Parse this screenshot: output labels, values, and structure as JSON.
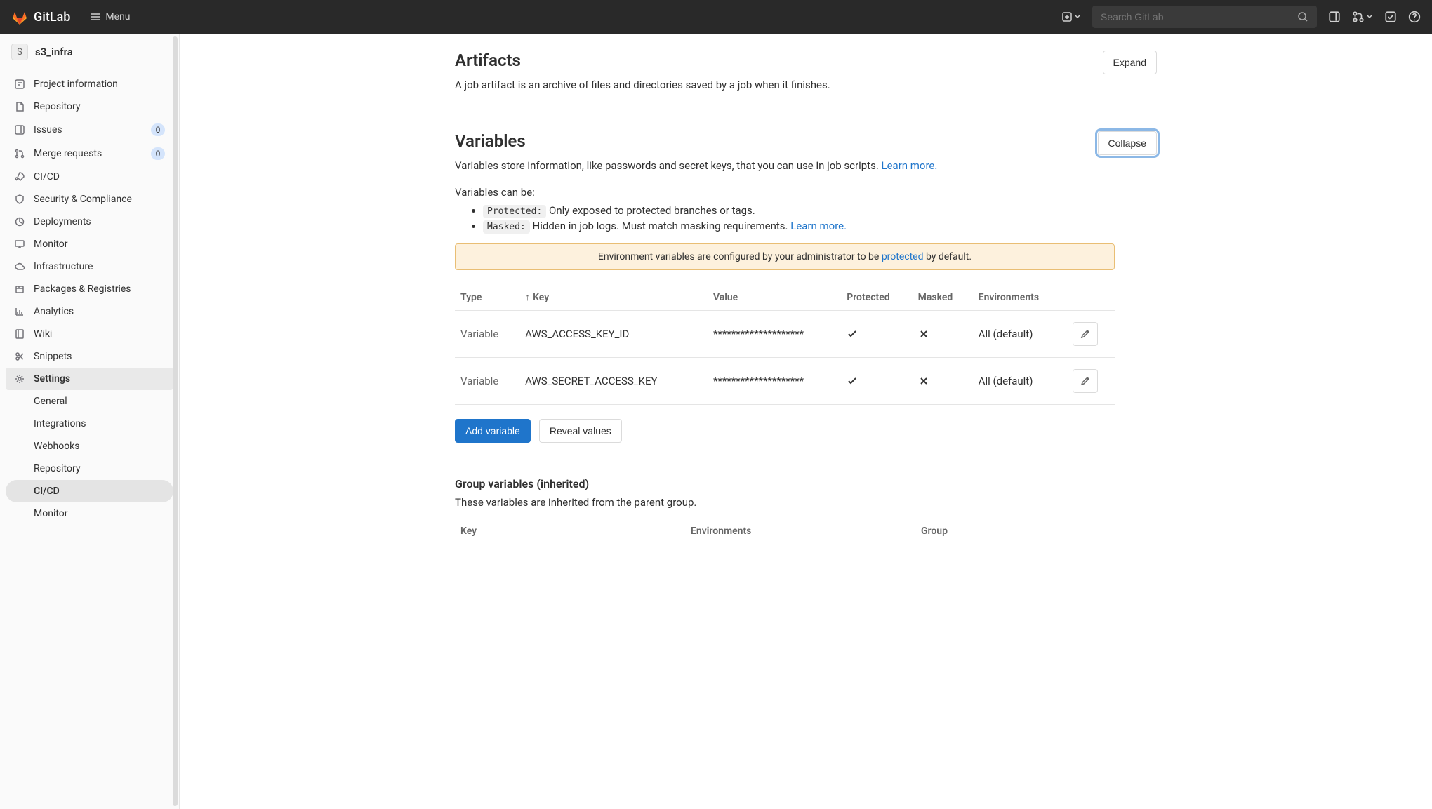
{
  "topbar": {
    "brand": "GitLab",
    "menu_label": "Menu",
    "search_placeholder": "Search GitLab"
  },
  "project": {
    "avatar_letter": "S",
    "name": "s3_infra"
  },
  "sidebar": {
    "items": [
      {
        "label": "Project information"
      },
      {
        "label": "Repository"
      },
      {
        "label": "Issues",
        "badge": "0"
      },
      {
        "label": "Merge requests",
        "badge": "0"
      },
      {
        "label": "CI/CD"
      },
      {
        "label": "Security & Compliance"
      },
      {
        "label": "Deployments"
      },
      {
        "label": "Monitor"
      },
      {
        "label": "Infrastructure"
      },
      {
        "label": "Packages & Registries"
      },
      {
        "label": "Analytics"
      },
      {
        "label": "Wiki"
      },
      {
        "label": "Snippets"
      },
      {
        "label": "Settings"
      }
    ],
    "settings_sub": [
      {
        "label": "General"
      },
      {
        "label": "Integrations"
      },
      {
        "label": "Webhooks"
      },
      {
        "label": "Repository"
      },
      {
        "label": "CI/CD"
      },
      {
        "label": "Monitor"
      }
    ]
  },
  "artifacts": {
    "title": "Artifacts",
    "desc": "A job artifact is an archive of files and directories saved by a job when it finishes.",
    "expand_label": "Expand"
  },
  "variables": {
    "title": "Variables",
    "collapse_label": "Collapse",
    "desc_prefix": "Variables store information, like passwords and secret keys, that you can use in job scripts. ",
    "learn_more": "Learn more.",
    "can_be": "Variables can be:",
    "protected_label": "Protected:",
    "protected_desc": " Only exposed to protected branches or tags.",
    "masked_label": "Masked:",
    "masked_desc": " Hidden in job logs. Must match masking requirements. ",
    "alert_prefix": "Environment variables are configured by your administrator to be ",
    "alert_link": "protected",
    "alert_suffix": " by default.",
    "cols": {
      "type": "Type",
      "key": "Key",
      "value": "Value",
      "protected": "Protected",
      "masked": "Masked",
      "envs": "Environments"
    },
    "rows": [
      {
        "type": "Variable",
        "key": "AWS_ACCESS_KEY_ID",
        "value": "********************",
        "protected": true,
        "masked": false,
        "envs": "All (default)"
      },
      {
        "type": "Variable",
        "key": "AWS_SECRET_ACCESS_KEY",
        "value": "********************",
        "protected": true,
        "masked": false,
        "envs": "All (default)"
      }
    ],
    "add_label": "Add variable",
    "reveal_label": "Reveal values"
  },
  "group_vars": {
    "title": "Group variables (inherited)",
    "desc": "These variables are inherited from the parent group.",
    "cols": {
      "key": "Key",
      "envs": "Environments",
      "group": "Group"
    }
  }
}
